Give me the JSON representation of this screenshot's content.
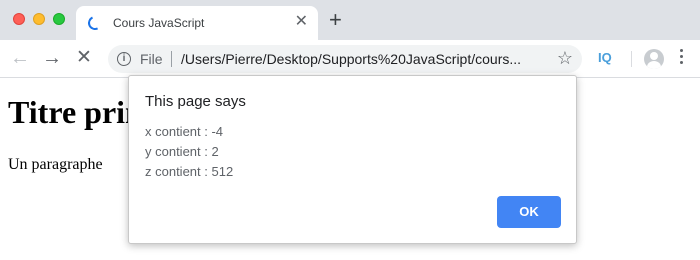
{
  "window": {
    "tab": {
      "title": "Cours JavaScript",
      "close_icon": "close-icon",
      "loading": true
    },
    "new_tab_icon": "plus-icon"
  },
  "toolbar": {
    "url_scheme": "File",
    "url": "/Users/Pierre/Desktop/Supports%20JavaScript/cours...",
    "extension_label": "IQ"
  },
  "page": {
    "heading": "Titre principal",
    "paragraph": "Un paragraphe"
  },
  "dialog": {
    "title": "This page says",
    "lines": [
      "x contient : -4",
      "y contient : 2",
      "z contient : 512"
    ],
    "ok_label": "OK",
    "ok_color": "#4285f4"
  }
}
